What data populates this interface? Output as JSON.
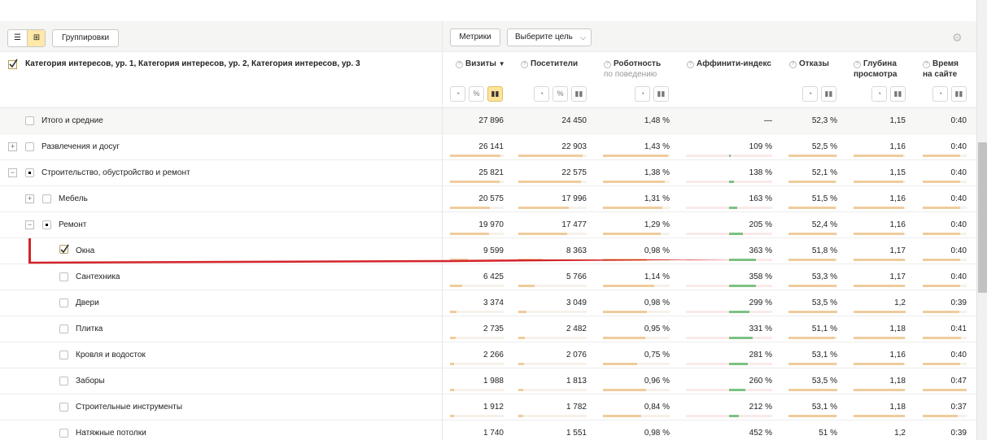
{
  "toolbar": {
    "groupings_label": "Группировки",
    "metrics_label": "Метрики",
    "goal_label": "Выберите цель",
    "list_view_icon": "list-icon",
    "tree_view_icon": "tree-icon",
    "settings_icon": "gear-icon"
  },
  "header": {
    "dimensions_title": "Категория интересов, ур. 1, Категория интересов, ур. 2, Категория интересов, ур. 3",
    "columns": [
      {
        "label": "Визиты",
        "sub": "",
        "sort": "▼"
      },
      {
        "label": "Посетители",
        "sub": ""
      },
      {
        "label": "Роботность",
        "sub": "по поведению"
      },
      {
        "label": "Аффинити-индекс",
        "sub": ""
      },
      {
        "label": "Отказы",
        "sub": ""
      },
      {
        "label": "Глубина",
        "sub": "просмотра"
      },
      {
        "label": "Время",
        "sub": "на сайте"
      }
    ]
  },
  "rows": [
    {
      "label": "Итого и средние",
      "visits": "27 896",
      "visitors": "24 450",
      "robot": "1,48 %",
      "affinity": "—",
      "bounce": "52,3 %",
      "depth": "1,15",
      "time": "0:40"
    },
    {
      "label": "Развлечения и досуг",
      "visits": "26 141",
      "visitors": "22 903",
      "robot": "1,43 %",
      "affinity": "109 %",
      "bounce": "52,5 %",
      "depth": "1,16",
      "time": "0:40"
    },
    {
      "label": "Строительство, обустройство и ремонт",
      "visits": "25 821",
      "visitors": "22 575",
      "robot": "1,38 %",
      "affinity": "138 %",
      "bounce": "52,1 %",
      "depth": "1,15",
      "time": "0:40"
    },
    {
      "label": "Мебель",
      "visits": "20 575",
      "visitors": "17 996",
      "robot": "1,31 %",
      "affinity": "163 %",
      "bounce": "51,5 %",
      "depth": "1,16",
      "time": "0:40"
    },
    {
      "label": "Ремонт",
      "visits": "19 970",
      "visitors": "17 477",
      "robot": "1,29 %",
      "affinity": "205 %",
      "bounce": "52,4 %",
      "depth": "1,16",
      "time": "0:40"
    },
    {
      "label": "Окна",
      "visits": "9 599",
      "visitors": "8 363",
      "robot": "0,98 %",
      "affinity": "363 %",
      "bounce": "51,8 %",
      "depth": "1,17",
      "time": "0:40"
    },
    {
      "label": "Сантехника",
      "visits": "6 425",
      "visitors": "5 766",
      "robot": "1,14 %",
      "affinity": "358 %",
      "bounce": "53,3 %",
      "depth": "1,17",
      "time": "0:40"
    },
    {
      "label": "Двери",
      "visits": "3 374",
      "visitors": "3 049",
      "robot": "0,98 %",
      "affinity": "299 %",
      "bounce": "53,5 %",
      "depth": "1,2",
      "time": "0:39"
    },
    {
      "label": "Плитка",
      "visits": "2 735",
      "visitors": "2 482",
      "robot": "0,95 %",
      "affinity": "331 %",
      "bounce": "51,1 %",
      "depth": "1,18",
      "time": "0:41"
    },
    {
      "label": "Кровля и водосток",
      "visits": "2 266",
      "visitors": "2 076",
      "robot": "0,75 %",
      "affinity": "281 %",
      "bounce": "53,1 %",
      "depth": "1,16",
      "time": "0:40"
    },
    {
      "label": "Заборы",
      "visits": "1 988",
      "visitors": "1 813",
      "robot": "0,96 %",
      "affinity": "260 %",
      "bounce": "53,5 %",
      "depth": "1,18",
      "time": "0:47"
    },
    {
      "label": "Строительные инструменты",
      "visits": "1 912",
      "visitors": "1 782",
      "robot": "0,84 %",
      "affinity": "212 %",
      "bounce": "53,1 %",
      "depth": "1,18",
      "time": "0:37"
    },
    {
      "label": "Натяжные потолки",
      "visits": "1 740",
      "visitors": "1 551",
      "robot": "0,98 %",
      "affinity": "452 %",
      "bounce": "51 %",
      "depth": "1,2",
      "time": "0:39"
    }
  ],
  "bar_fractions": {
    "visits": [
      0,
      0.94,
      0.93,
      0.74,
      0.72,
      0.34,
      0.23,
      0.12,
      0.1,
      0.08,
      0.07,
      0.07,
      0.06
    ],
    "visitors": [
      0,
      0.94,
      0.92,
      0.74,
      0.71,
      0.34,
      0.24,
      0.12,
      0.1,
      0.08,
      0.07,
      0.07,
      0.06
    ],
    "robot": [
      0,
      0.97,
      0.93,
      0.89,
      0.87,
      0.66,
      0.77,
      0.66,
      0.64,
      0.51,
      0.65,
      0.57,
      0.66
    ],
    "affinity": [
      0,
      0.03,
      0.12,
      0.18,
      0.33,
      0.63,
      0.62,
      0.47,
      0.55,
      0.43,
      0.37,
      0.22,
      0.88
    ],
    "bounce": [
      0,
      0.98,
      0.97,
      0.96,
      0.98,
      0.97,
      0.99,
      1.0,
      0.95,
      0.99,
      1.0,
      0.99,
      0.95
    ],
    "depth": [
      0,
      0.96,
      0.96,
      0.97,
      0.97,
      0.98,
      0.98,
      1.0,
      0.98,
      0.97,
      0.98,
      0.98,
      1.0
    ],
    "time": [
      0,
      0.85,
      0.85,
      0.85,
      0.85,
      0.85,
      0.85,
      0.83,
      0.87,
      0.85,
      1.0,
      0.79,
      0.83
    ]
  },
  "colors": {
    "accent_yellow": "#ffe39a",
    "bar_orange": "#efcc9c",
    "affinity_green": "#7cc283",
    "highlight_red": "#d4242a"
  }
}
